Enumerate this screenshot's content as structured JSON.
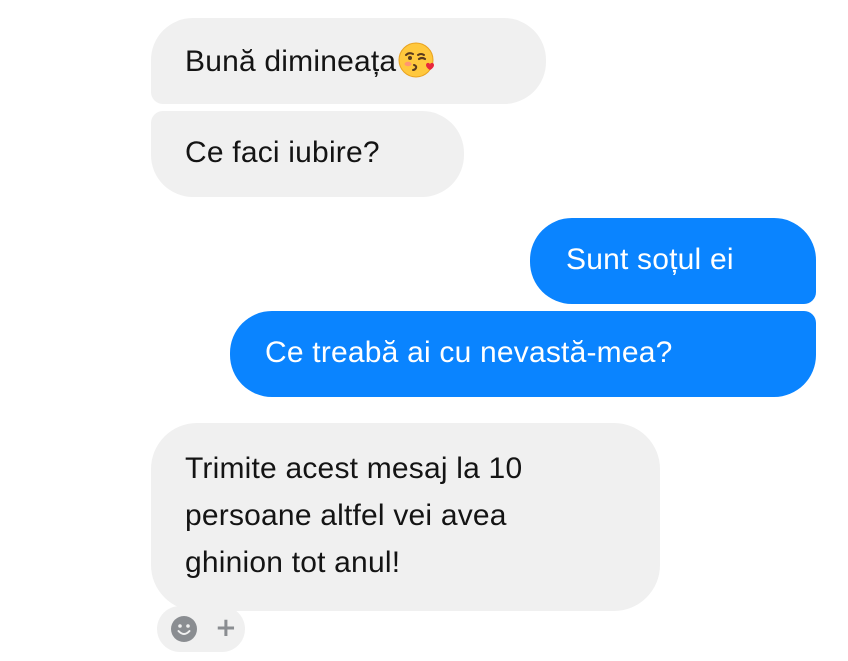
{
  "conversation": {
    "messages": [
      {
        "id": "msg-1",
        "direction": "incoming",
        "text": "Bună dimineața",
        "emoji": "kissing-face-with-heart-emoji"
      },
      {
        "id": "msg-2",
        "direction": "incoming",
        "text": "Ce faci iubire?"
      },
      {
        "id": "msg-3",
        "direction": "outgoing",
        "text": "Sunt soțul ei"
      },
      {
        "id": "msg-4",
        "direction": "outgoing",
        "text": "Ce treabă ai cu nevastă-mea?"
      },
      {
        "id": "msg-5",
        "direction": "incoming",
        "lines": [
          "Trimite acest mesaj la 10",
          "persoane altfel vei avea",
          "ghinion tot anul!"
        ]
      }
    ]
  },
  "reaction_bar": {
    "icon": "smiley-face-icon",
    "add_label": "+"
  },
  "colors": {
    "incoming_bubble": "#f0f0f0",
    "outgoing_bubble": "#0a84ff",
    "incoming_text": "#141414",
    "outgoing_text": "#ffffff"
  }
}
